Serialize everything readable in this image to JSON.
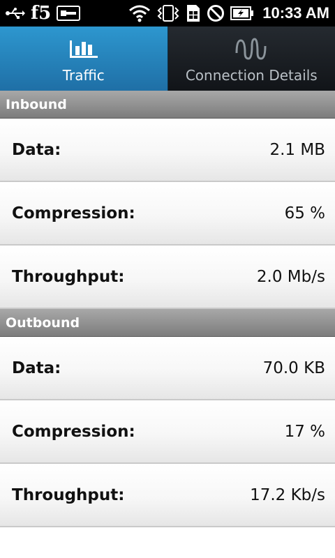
{
  "status_bar": {
    "carrier_logo": "f5",
    "time": "10:33 AM",
    "icons": [
      "usb-icon",
      "key-icon",
      "wifi-icon",
      "vibrate-icon",
      "sim-icon",
      "no-signal-icon",
      "battery-charging-icon"
    ]
  },
  "tabs": [
    {
      "label": "Traffic",
      "icon": "bar-chart-icon",
      "active": true
    },
    {
      "label": "Connection Details",
      "icon": "connection-wave-icon",
      "active": false
    }
  ],
  "sections": {
    "inbound": {
      "title": "Inbound",
      "rows": [
        {
          "label": "Data:",
          "value": "2.1 MB"
        },
        {
          "label": "Compression:",
          "value": "65 %"
        },
        {
          "label": "Throughput:",
          "value": "2.0 Mb/s"
        }
      ]
    },
    "outbound": {
      "title": "Outbound",
      "rows": [
        {
          "label": "Data:",
          "value": "70.0 KB"
        },
        {
          "label": "Compression:",
          "value": "17 %"
        },
        {
          "label": "Throughput:",
          "value": "17.2 Kb/s"
        }
      ]
    }
  },
  "colors": {
    "active_tab": "#2d97cf",
    "inactive_tab": "#1a1e23",
    "section_header": "#8f8f8f"
  }
}
